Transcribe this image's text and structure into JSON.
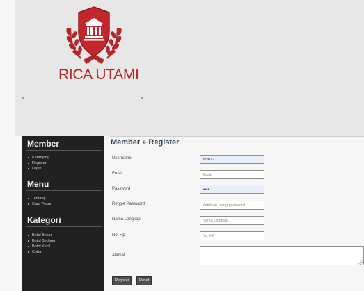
{
  "brand": {
    "title": "RICA UTAMI",
    "logo_icon": "courthouse-shield-laurel-icon",
    "brand_color": "#b3262a"
  },
  "sidebar": {
    "sections": [
      {
        "heading": "Member",
        "items": [
          "Keranjang",
          "Register",
          "Login"
        ]
      },
      {
        "heading": "Menu",
        "items": [
          "Tentang",
          "Cara Pesan"
        ]
      },
      {
        "heading": "Kategori",
        "items": [
          "Botol Besar",
          "Botol Sedang",
          "Botol Kecil",
          "Coba"
        ]
      }
    ]
  },
  "content": {
    "title": "Member » Register"
  },
  "form": {
    "username": {
      "label": "Username",
      "value": "KSR12",
      "placeholder": ""
    },
    "email": {
      "label": "Email",
      "value": "",
      "placeholder": "Email"
    },
    "password": {
      "label": "Password",
      "value": "•••••",
      "placeholder": ""
    },
    "retype_password": {
      "label": "Retype Password",
      "value": "",
      "placeholder": "Ketikkan ulang password"
    },
    "full_name": {
      "label": "Nama Lengkap",
      "value": "",
      "placeholder": "Nama Lengkap"
    },
    "phone": {
      "label": "No. Hp",
      "value": "",
      "placeholder": "No. HP"
    },
    "address": {
      "label": "Alamat",
      "value": ""
    },
    "register_label": "Register",
    "reset_label": "Reset"
  }
}
